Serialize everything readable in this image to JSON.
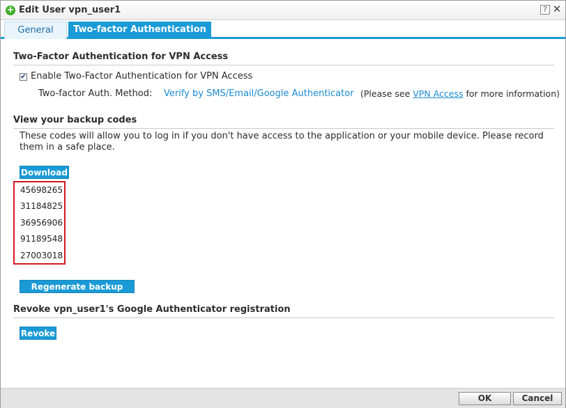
{
  "window": {
    "title": "Edit User vpn_user1",
    "icon": "add-circle-icon",
    "help_label": "?",
    "close_label": "✕"
  },
  "tabs": [
    {
      "label": "General",
      "active": false
    },
    {
      "label": "Two-factor Authentication",
      "active": true
    }
  ],
  "twofa_section": {
    "heading": "Two-Factor Authentication for VPN Access",
    "checkbox_label": "Enable Two-Factor Authentication for VPN Access",
    "checked": true,
    "method_label": "Two-factor Auth. Method:",
    "method_value": "Verify by SMS/Email/Google Authenticator",
    "note_prefix": "(Please see ",
    "note_link": "VPN Access",
    "note_suffix": " for more information)"
  },
  "backup_section": {
    "heading": "View your backup codes",
    "description": "These codes will allow you to log in if you don't have access to the application or your mobile device. Please record them in a safe place.",
    "download_label": "Download",
    "codes": [
      "45698265",
      "31184825",
      "36956906",
      "91189548",
      "27003018"
    ],
    "regenerate_label": "Regenerate backup codes"
  },
  "revoke_section": {
    "heading": "Revoke vpn_user1's Google Authenticator registration",
    "revoke_label": "Revoke"
  },
  "footer": {
    "ok_label": "OK",
    "cancel_label": "Cancel"
  },
  "colors": {
    "accent": "#1a9ad6",
    "highlight_border": "#d0191f",
    "link": "#1a8ad0"
  }
}
